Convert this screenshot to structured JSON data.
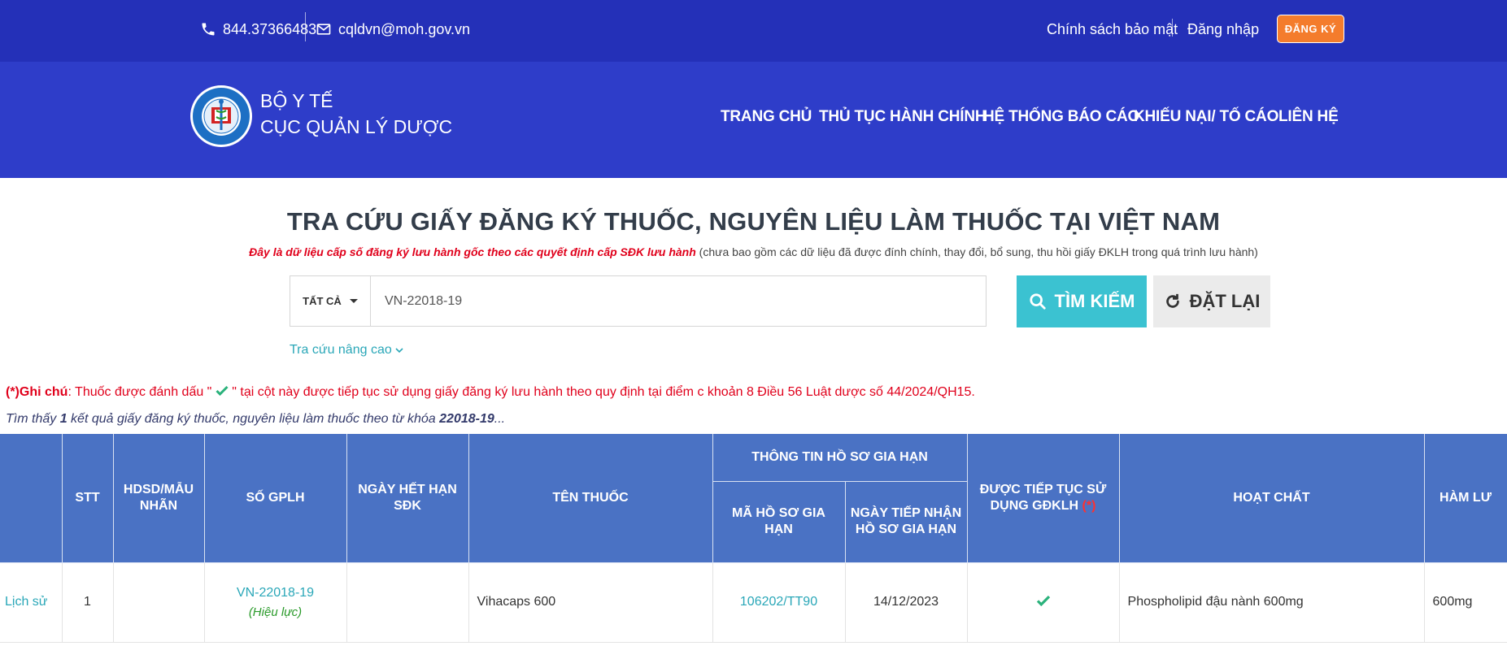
{
  "topbar": {
    "phone": "844.37366483",
    "email": "cqldvn@moh.gov.vn",
    "privacy": "Chính sách bảo mật",
    "login": "Đăng nhập",
    "register": "ĐĂNG KÝ"
  },
  "header": {
    "brand_line1": "BỘ Y TẾ",
    "brand_line2": "CỤC QUẢN LÝ DƯỢC",
    "nav": {
      "home": "TRANG CHỦ",
      "procedures": "THỦ TỤC HÀNH CHÍNH",
      "reports": "HỆ THỐNG BÁO CÁO",
      "complaints": "KHIẾU NẠI/ TỐ CÁO",
      "contact": "LIÊN HỆ"
    }
  },
  "main": {
    "title": "TRA CỨU GIẤY ĐĂNG KÝ THUỐC, NGUYÊN LIỆU LÀM THUỐC TẠI VIỆT NAM",
    "subtitle_red": "Đây là dữ liệu cấp số đăng ký lưu hành gốc theo các quyết định cấp SĐK lưu hành",
    "subtitle_gray": " (chưa bao gồm các dữ liệu đã được đính chính, thay đổi, bổ sung, thu hồi giấy ĐKLH trong quá trình lưu hành)",
    "search": {
      "type": "TẤT CẢ",
      "value": "VN-22018-19",
      "search_label": "TÌM KIẾM",
      "reset_label": "ĐẶT LẠI"
    },
    "advanced": "Tra cứu nâng cao",
    "note_prefix": "(*)Ghi chú",
    "note_text1": ": Thuốc được đánh dấu \" ",
    "note_text2": " \" tại cột này được tiếp tục sử dụng giấy đăng ký lưu hành theo quy định tại điểm c khoản 8 Điều 56 Luật dược số 44/2024/QH15.",
    "found_prefix": "Tìm thấy ",
    "found_count": "1",
    "found_middle": " kết quả giấy đăng ký thuốc, nguyên liệu làm thuốc theo từ khóa ",
    "found_keyword": "22018-19",
    "found_suffix": "..."
  },
  "table": {
    "headers": {
      "stt": "STT",
      "hdsd": "HDSD/MẪU NHÃN",
      "so_gplh": "SỐ GPLH",
      "ngay_het_han": "NGÀY HẾT HẠN SĐK",
      "ten_thuoc": "TÊN THUỐC",
      "group_gia_han": "THÔNG TIN HỒ SƠ GIA HẠN",
      "ma_ho_so": "MÃ HỒ SƠ GIA HẠN",
      "ngay_tiep_nhan": "NGÀY TIẾP NHẬN HỒ SƠ GIA HẠN",
      "tiep_tuc": "ĐƯỢC TIẾP TỤC SỬ DỤNG GĐKLH",
      "tiep_tuc_mark": "(*)",
      "hoat_chat": "HOẠT CHẤT",
      "ham_luong": "HÀM LƯ"
    },
    "rows": [
      {
        "history": "Lịch sử",
        "stt": "1",
        "hdsd": "",
        "so_gplh": "VN-22018-19",
        "status": "(Hiệu lực)",
        "ngay_het_han": "",
        "ten_thuoc": "Vihacaps 600",
        "ma_ho_so": "106202/TT90",
        "ngay_tiep_nhan": "14/12/2023",
        "hoat_chat": "Phospholipid đậu nành 600mg",
        "ham_luong": "600mg"
      }
    ]
  },
  "colors": {
    "topbar": "#2430b8",
    "header": "#2e3dc9",
    "accent": "#3bc2d1",
    "register": "#f47c2c",
    "table_header": "#4a72c4",
    "check": "#2ab27b"
  }
}
